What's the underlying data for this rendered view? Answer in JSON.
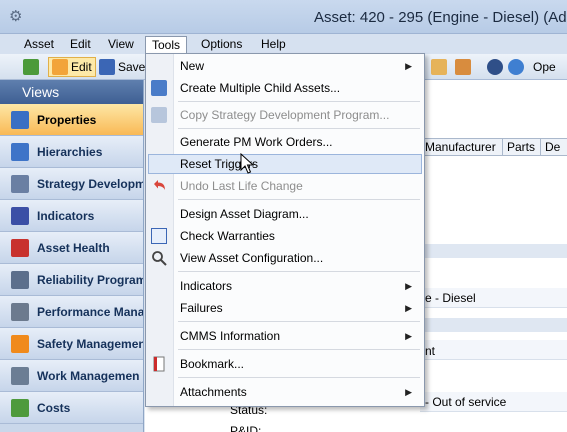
{
  "window": {
    "title": "Asset: 420 - 295 (Engine - Diesel) (Adr"
  },
  "menubar": {
    "items": [
      {
        "label": "Asset"
      },
      {
        "label": "Edit"
      },
      {
        "label": "View"
      },
      {
        "label": "Tools"
      },
      {
        "label": "Options"
      },
      {
        "label": "Help"
      }
    ]
  },
  "toolbar": {
    "edit_label": "Edit",
    "save_label": "Save",
    "open_label": "Ope"
  },
  "sidebar": {
    "header": "Views",
    "items": [
      {
        "label": "Properties",
        "icon": "properties-icon",
        "color": "#3a6fc4"
      },
      {
        "label": "Hierarchies",
        "icon": "hierarchies-icon",
        "color": "#3e74c8"
      },
      {
        "label": "Strategy Developm",
        "icon": "strategy-icon",
        "color": "#6a7fa3"
      },
      {
        "label": "Indicators",
        "icon": "indicators-icon",
        "color": "#3b4fa6"
      },
      {
        "label": "Asset Health",
        "icon": "asset-health-icon",
        "color": "#c8322e"
      },
      {
        "label": "Reliability Program",
        "icon": "reliability-icon",
        "color": "#5c6f8c"
      },
      {
        "label": "Performance Mana",
        "icon": "performance-icon",
        "color": "#6c7a8e"
      },
      {
        "label": "Safety Managemen",
        "icon": "safety-cone-icon",
        "color": "#f08a1c"
      },
      {
        "label": "Work Managemen",
        "icon": "work-icon",
        "color": "#6b7d94"
      },
      {
        "label": "Costs",
        "icon": "costs-icon",
        "color": "#4e9a3c"
      }
    ]
  },
  "tools_menu": {
    "items": [
      {
        "label": "New",
        "submenu": true,
        "disabled": false
      },
      {
        "label": "Create Multiple Child Assets...",
        "submenu": false,
        "disabled": false
      },
      {
        "label": "Copy Strategy Development Program...",
        "submenu": false,
        "disabled": true
      },
      {
        "label": "Generate PM Work Orders...",
        "submenu": false,
        "disabled": false
      },
      {
        "label": "Reset Triggers",
        "submenu": false,
        "disabled": false,
        "hover": true
      },
      {
        "label": "Undo Last Life Change",
        "submenu": false,
        "disabled": true
      },
      {
        "label": "Design Asset Diagram...",
        "submenu": false,
        "disabled": false
      },
      {
        "label": "Check Warranties",
        "submenu": false,
        "disabled": false
      },
      {
        "label": "View Asset Configuration...",
        "submenu": false,
        "disabled": false
      },
      {
        "label": "Indicators",
        "submenu": true,
        "disabled": false
      },
      {
        "label": "Failures",
        "submenu": true,
        "disabled": false
      },
      {
        "label": "CMMS Information",
        "submenu": true,
        "disabled": false
      },
      {
        "label": "Bookmark...",
        "submenu": false,
        "disabled": false
      },
      {
        "label": "Attachments",
        "submenu": true,
        "disabled": false
      }
    ]
  },
  "grid": {
    "columns": [
      "Manufacturer",
      "Parts",
      "De"
    ],
    "visible_text": {
      "type_value": "e - Diesel",
      "status_value": "nt",
      "service_value": "- Out of service",
      "status_label": "Status:",
      "pid_label": "P&ID:"
    }
  }
}
